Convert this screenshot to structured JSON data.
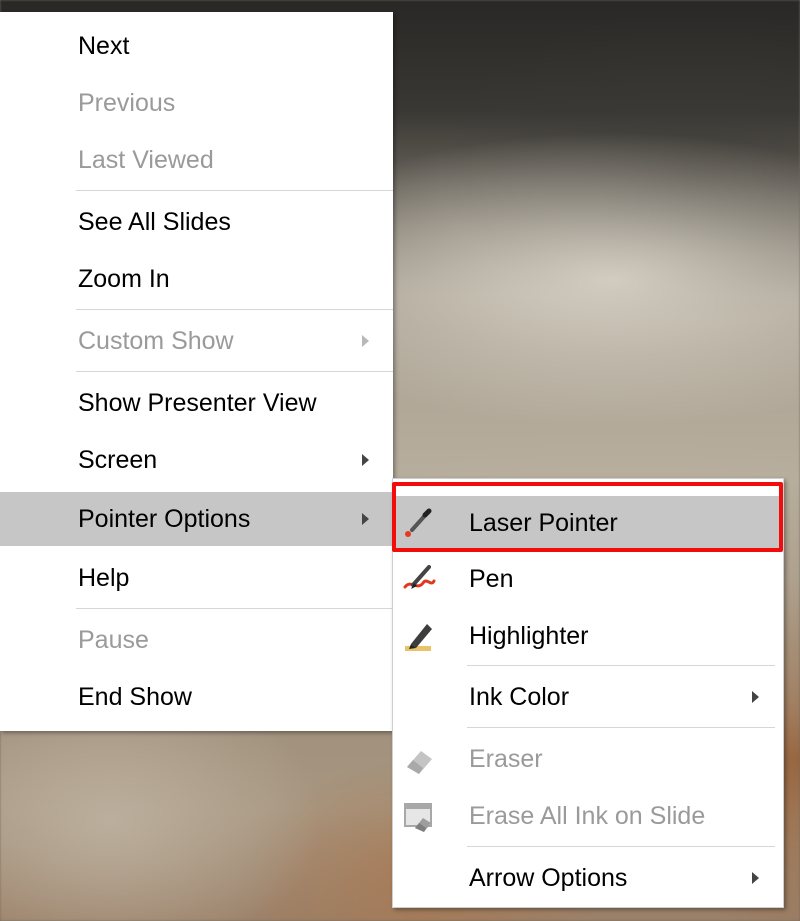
{
  "main_menu": {
    "items": [
      {
        "label": "Next",
        "enabled": true
      },
      {
        "label": "Previous",
        "enabled": false
      },
      {
        "label": "Last Viewed",
        "enabled": false
      },
      {
        "label": "See All Slides",
        "enabled": true
      },
      {
        "label": "Zoom In",
        "enabled": true
      },
      {
        "label": "Custom Show",
        "enabled": false,
        "submenu": true
      },
      {
        "label": "Show Presenter View",
        "enabled": true
      },
      {
        "label": "Screen",
        "enabled": true,
        "submenu": true
      },
      {
        "label": "Pointer Options",
        "enabled": true,
        "submenu": true,
        "hovered": true
      },
      {
        "label": "Help",
        "enabled": true
      },
      {
        "label": "Pause",
        "enabled": false
      },
      {
        "label": "End Show",
        "enabled": true
      }
    ]
  },
  "pointer_submenu": {
    "items": [
      {
        "label": "Laser Pointer",
        "icon": "laser-pointer-icon",
        "enabled": true,
        "hovered": true
      },
      {
        "label": "Pen",
        "icon": "pen-icon",
        "enabled": true
      },
      {
        "label": "Highlighter",
        "icon": "highlighter-icon",
        "enabled": true
      },
      {
        "label": "Ink Color",
        "enabled": true,
        "submenu": true
      },
      {
        "label": "Eraser",
        "icon": "eraser-icon",
        "enabled": false
      },
      {
        "label": "Erase All Ink on Slide",
        "icon": "erase-all-ink-icon",
        "enabled": false
      },
      {
        "label": "Arrow Options",
        "enabled": true,
        "submenu": true
      }
    ]
  },
  "colors": {
    "hover": "#c6c6c6",
    "highlight_outline": "#f20d0d",
    "disabled_text": "#9a9a9a"
  }
}
